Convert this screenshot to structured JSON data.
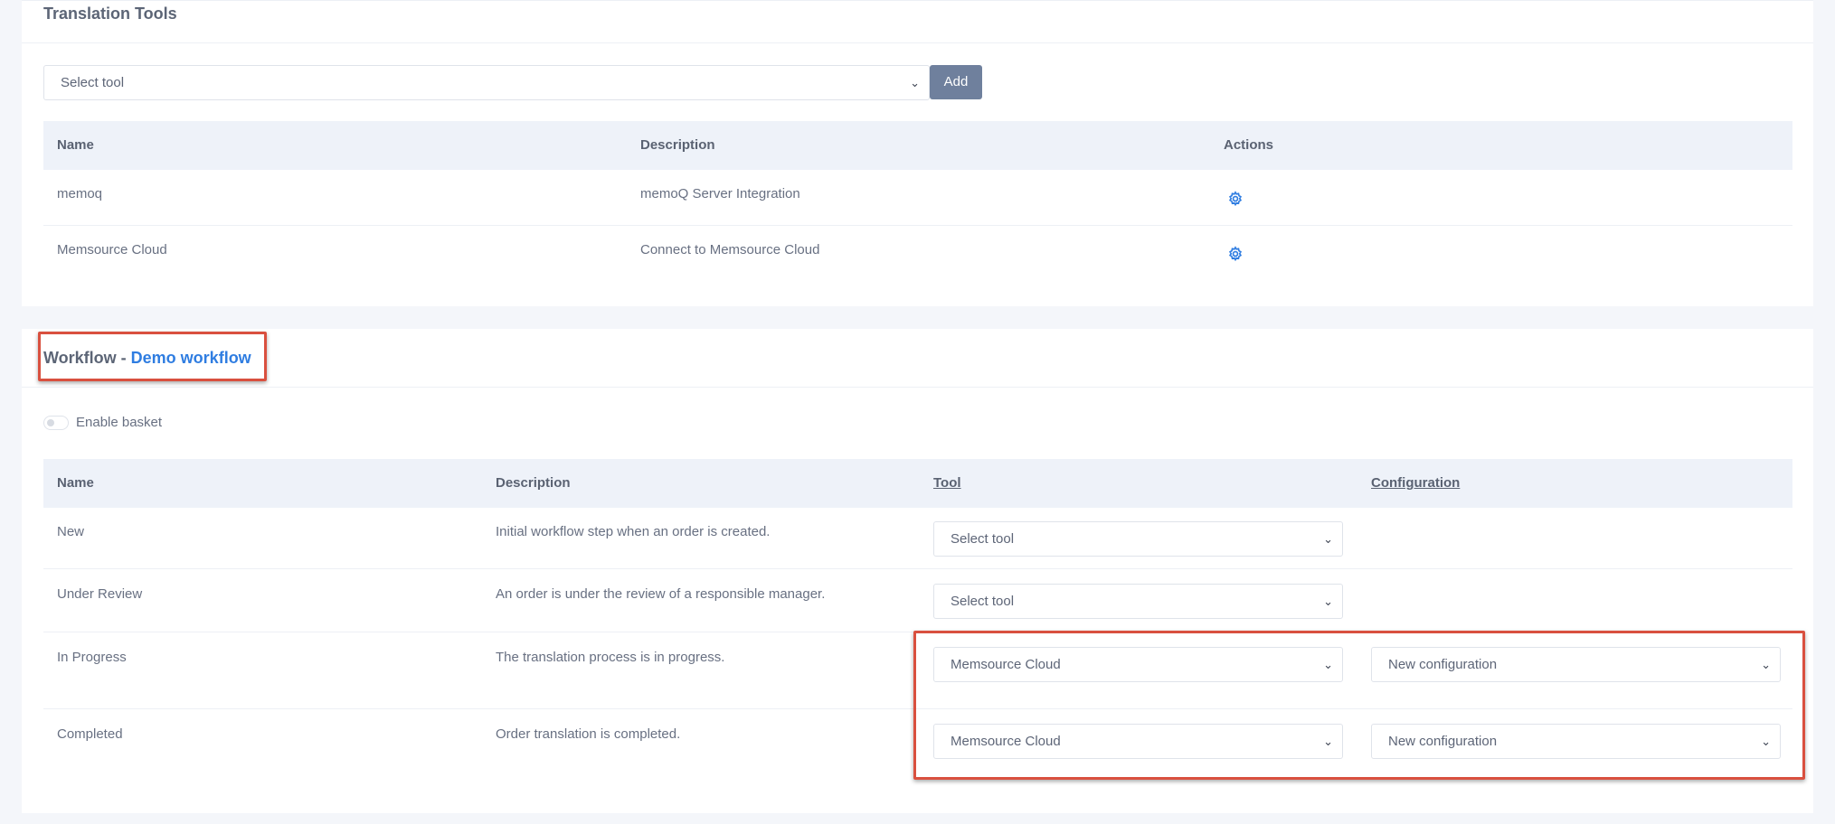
{
  "translation_tools": {
    "title": "Translation Tools",
    "select_placeholder": "Select tool",
    "add_label": "Add",
    "columns": [
      "Name",
      "Description",
      "Actions"
    ],
    "rows": [
      {
        "name": "memoq",
        "description": "memoQ Server Integration",
        "action_icon": "gear-icon"
      },
      {
        "name": "Memsource Cloud",
        "description": "Connect to Memsource Cloud",
        "action_icon": "gear-icon"
      }
    ]
  },
  "workflow": {
    "title_prefix": "Workflow - ",
    "title_link": "Demo workflow",
    "basket_label": "Enable basket",
    "basket_enabled": false,
    "columns": [
      "Name",
      "Description",
      "Tool",
      "Configuration"
    ],
    "rows": [
      {
        "name": "New",
        "description": "Initial workflow step when an order is created.",
        "tool": "Select tool",
        "configuration": ""
      },
      {
        "name": "Under Review",
        "description": "An order is under the review of a responsible manager.",
        "tool": "Select tool",
        "configuration": ""
      },
      {
        "name": "In Progress",
        "description": "The translation process is in progress.",
        "tool": "Memsource Cloud",
        "configuration": "New configuration"
      },
      {
        "name": "Completed",
        "description": "Order translation is completed.",
        "tool": "Memsource Cloud",
        "configuration": "New configuration"
      }
    ]
  },
  "colors": {
    "accent": "#2f7de1",
    "highlight": "#d9503f",
    "header_bg": "#eef2f9",
    "button_bg": "#6f809d"
  }
}
